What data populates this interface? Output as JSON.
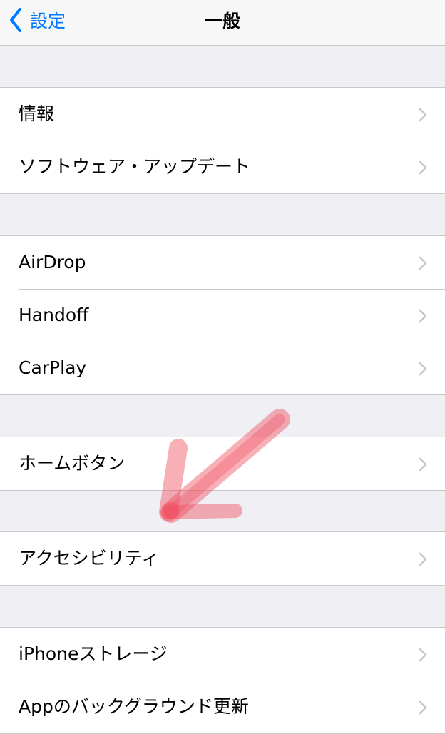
{
  "navbar": {
    "back_label": "設定",
    "title": "一般"
  },
  "groups": [
    {
      "items": [
        {
          "label": "情報"
        },
        {
          "label": "ソフトウェア・アップデート"
        }
      ]
    },
    {
      "items": [
        {
          "label": "AirDrop"
        },
        {
          "label": "Handoff"
        },
        {
          "label": "CarPlay"
        }
      ]
    },
    {
      "items": [
        {
          "label": "ホームボタン"
        }
      ]
    },
    {
      "items": [
        {
          "label": "アクセシビリティ"
        }
      ]
    },
    {
      "items": [
        {
          "label": "iPhoneストレージ"
        },
        {
          "label": "Appのバックグラウンド更新"
        }
      ]
    }
  ],
  "colors": {
    "accent": "#007aff",
    "annotation_arrow": "#f0505f",
    "background": "#efeff4",
    "chevron": "#c7c7cc"
  },
  "icons": {
    "back": "chevron-left-icon",
    "disclosure": "chevron-right-icon"
  }
}
